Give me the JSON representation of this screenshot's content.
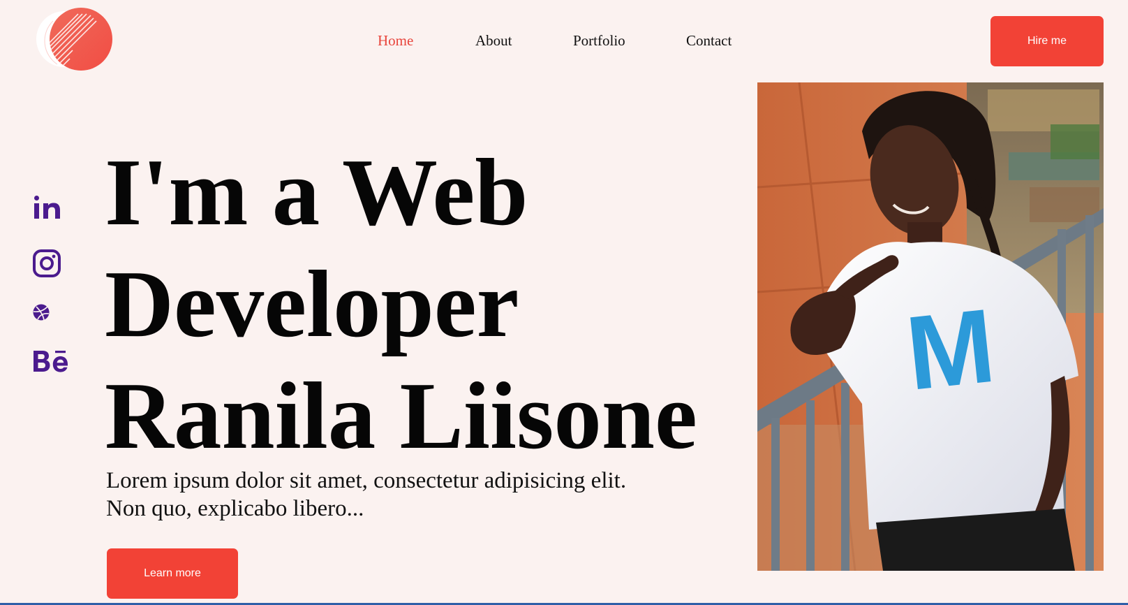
{
  "nav": {
    "items": [
      {
        "label": "Home",
        "active": true
      },
      {
        "label": "About",
        "active": false
      },
      {
        "label": "Portfolio",
        "active": false
      },
      {
        "label": "Contact",
        "active": false
      }
    ],
    "hire_label": "Hire me"
  },
  "hero": {
    "headline_lines": [
      "I'm a Web",
      "Developer",
      "Ranila Liisone"
    ],
    "lede_lines": [
      "Lorem ipsum dolor sit amet, consectetur adipisicing elit.",
      "Non quo, explicabo libero..."
    ],
    "cta_label": "Learn more"
  },
  "social": {
    "icons": [
      "linkedin-icon",
      "instagram-icon",
      "dribbble-icon",
      "behance-icon"
    ],
    "behance_text": "Bē",
    "linkedin_text": "in"
  },
  "photo": {
    "shirt_letter": "M"
  },
  "colors": {
    "background": "#fbf2f0",
    "accent": "#f24236",
    "active_nav": "#e8453c",
    "social": "#4b1b8e"
  }
}
